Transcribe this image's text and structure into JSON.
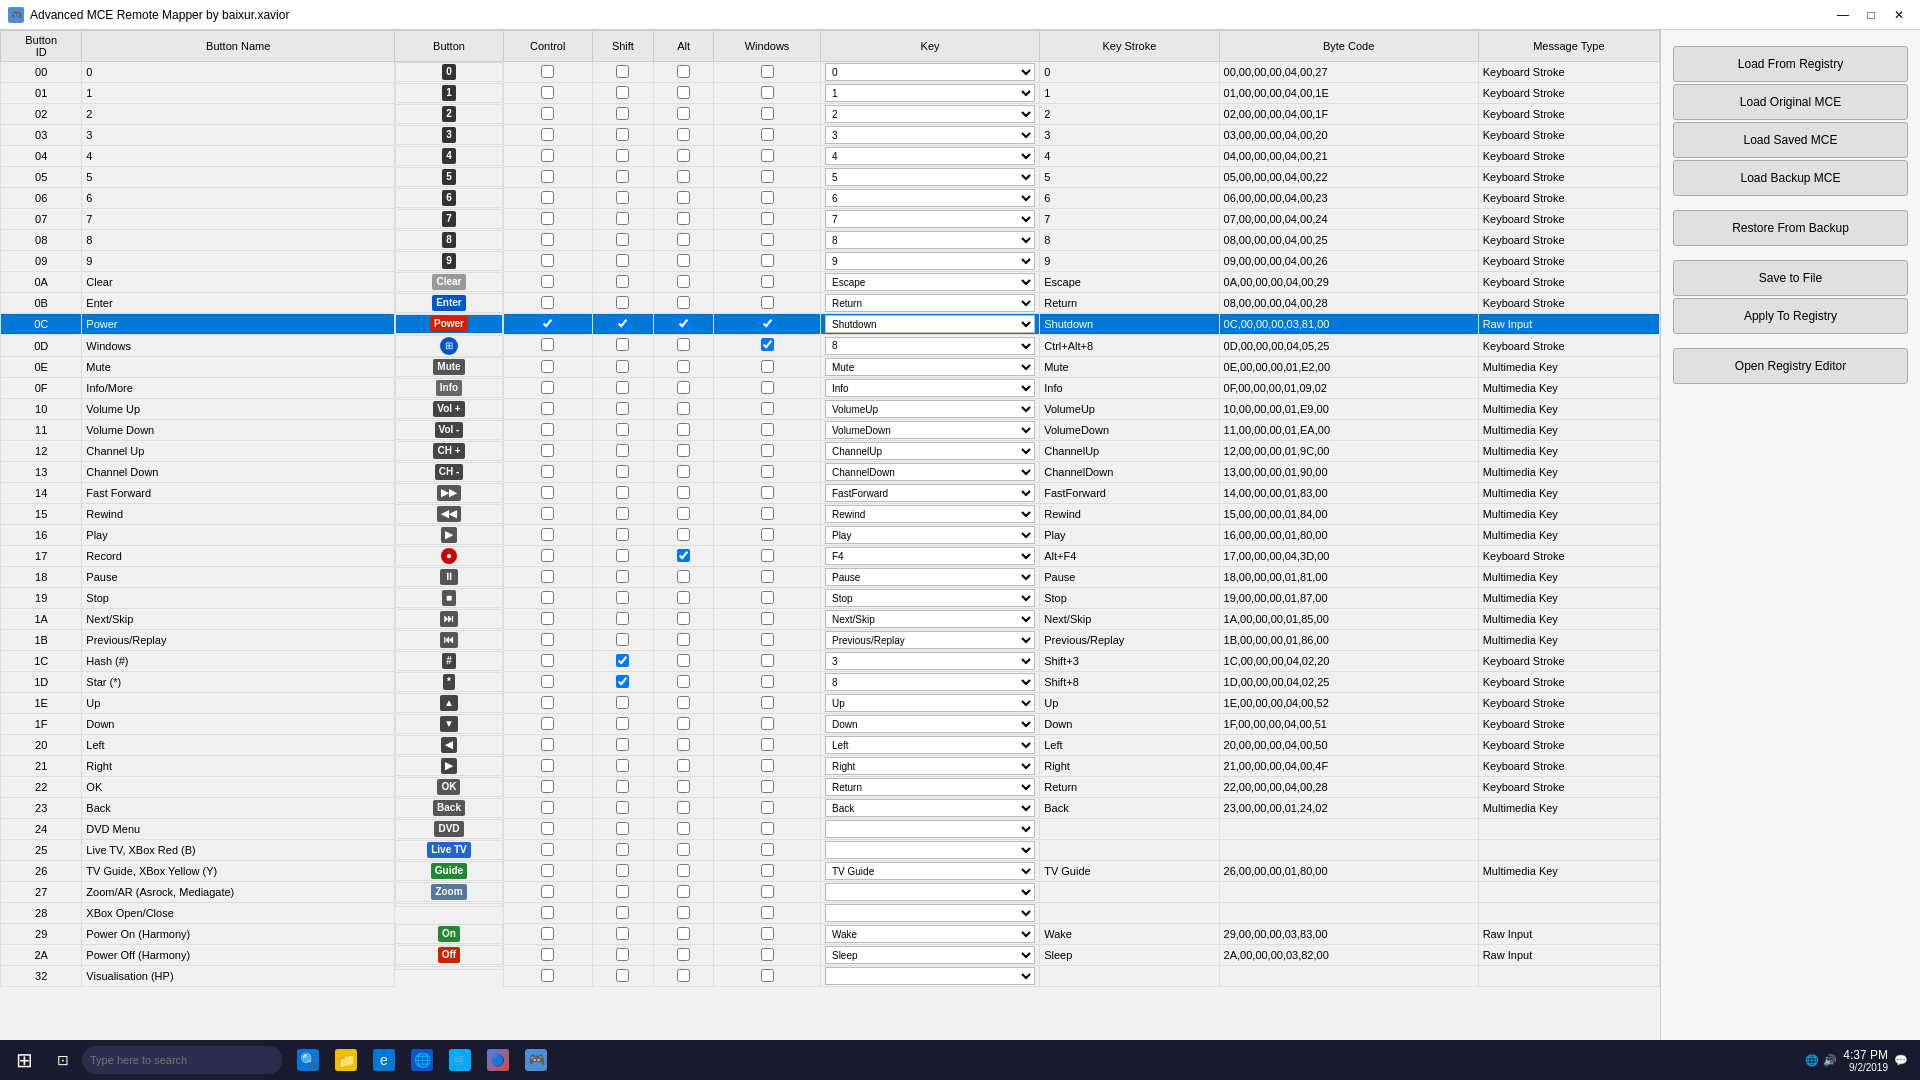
{
  "app": {
    "title": "Advanced MCE Remote Mapper by baixur.xavior",
    "icon": "🎮"
  },
  "titlebar": {
    "minimize": "—",
    "maximize": "□",
    "close": "✕"
  },
  "table": {
    "headers": [
      "Button ID",
      "Button Name",
      "Button",
      "Control",
      "Shift",
      "Alt",
      "Windows",
      "Key",
      "Key Stroke",
      "Byte Code",
      "Message Type"
    ],
    "rows": [
      {
        "id": "00",
        "name": "0",
        "btn": "0",
        "btn_class": "btn-dark",
        "ctrl": false,
        "shift": false,
        "alt": false,
        "win": false,
        "key": "0",
        "keystroke": "0",
        "bytecode": "00,00,00,00,04,00,27",
        "msgtype": "Keyboard Stroke"
      },
      {
        "id": "01",
        "name": "1",
        "btn": "1",
        "btn_class": "btn-dark",
        "ctrl": false,
        "shift": false,
        "alt": false,
        "win": false,
        "key": "1",
        "keystroke": "1",
        "bytecode": "01,00,00,00,04,00,1E",
        "msgtype": "Keyboard Stroke"
      },
      {
        "id": "02",
        "name": "2",
        "btn": "2",
        "btn_class": "btn-dark",
        "ctrl": false,
        "shift": false,
        "alt": false,
        "win": false,
        "key": "2",
        "keystroke": "2",
        "bytecode": "02,00,00,00,04,00,1F",
        "msgtype": "Keyboard Stroke"
      },
      {
        "id": "03",
        "name": "3",
        "btn": "3",
        "btn_class": "btn-dark",
        "ctrl": false,
        "shift": false,
        "alt": false,
        "win": false,
        "key": "3",
        "keystroke": "3",
        "bytecode": "03,00,00,00,04,00,20",
        "msgtype": "Keyboard Stroke"
      },
      {
        "id": "04",
        "name": "4",
        "btn": "4",
        "btn_class": "btn-dark",
        "ctrl": false,
        "shift": false,
        "alt": false,
        "win": false,
        "key": "4",
        "keystroke": "4",
        "bytecode": "04,00,00,00,04,00,21",
        "msgtype": "Keyboard Stroke"
      },
      {
        "id": "05",
        "name": "5",
        "btn": "5",
        "btn_class": "btn-dark",
        "ctrl": false,
        "shift": false,
        "alt": false,
        "win": false,
        "key": "5",
        "keystroke": "5",
        "bytecode": "05,00,00,00,04,00,22",
        "msgtype": "Keyboard Stroke"
      },
      {
        "id": "06",
        "name": "6",
        "btn": "6",
        "btn_class": "btn-dark",
        "ctrl": false,
        "shift": false,
        "alt": false,
        "win": false,
        "key": "6",
        "keystroke": "6",
        "bytecode": "06,00,00,00,04,00,23",
        "msgtype": "Keyboard Stroke"
      },
      {
        "id": "07",
        "name": "7",
        "btn": "7",
        "btn_class": "btn-dark",
        "ctrl": false,
        "shift": false,
        "alt": false,
        "win": false,
        "key": "7",
        "keystroke": "7",
        "bytecode": "07,00,00,00,04,00,24",
        "msgtype": "Keyboard Stroke"
      },
      {
        "id": "08",
        "name": "8",
        "btn": "8",
        "btn_class": "btn-dark",
        "ctrl": false,
        "shift": false,
        "alt": false,
        "win": false,
        "key": "8",
        "keystroke": "8",
        "bytecode": "08,00,00,00,04,00,25",
        "msgtype": "Keyboard Stroke"
      },
      {
        "id": "09",
        "name": "9",
        "btn": "9",
        "btn_class": "btn-dark",
        "ctrl": false,
        "shift": false,
        "alt": false,
        "win": false,
        "key": "9",
        "keystroke": "9",
        "bytecode": "09,00,00,00,04,00,26",
        "msgtype": "Keyboard Stroke"
      },
      {
        "id": "0A",
        "name": "Clear",
        "btn": "Clear",
        "btn_class": "btn-gray",
        "ctrl": false,
        "shift": false,
        "alt": false,
        "win": false,
        "key": "Escape",
        "keystroke": "Escape",
        "bytecode": "0A,00,00,00,04,00,29",
        "msgtype": "Keyboard Stroke"
      },
      {
        "id": "0B",
        "name": "Enter",
        "btn": "Enter",
        "btn_class": "btn-blue",
        "ctrl": false,
        "shift": false,
        "alt": false,
        "win": false,
        "key": "Return",
        "keystroke": "Return",
        "bytecode": "08,00,00,00,04,00,28",
        "msgtype": "Keyboard Stroke"
      },
      {
        "id": "0C",
        "name": "Power",
        "btn": "Power",
        "btn_class": "btn-power",
        "ctrl": true,
        "shift": true,
        "alt": true,
        "win": true,
        "key": "Shutdown",
        "keystroke": "Shutdown",
        "bytecode": "0C,00,00,00,03,81,00",
        "msgtype": "Raw Input",
        "selected": true
      },
      {
        "id": "0D",
        "name": "Windows",
        "btn": "win",
        "btn_class": "btn-windows",
        "ctrl": false,
        "shift": false,
        "alt": false,
        "win": true,
        "key": "8",
        "keystroke": "Ctrl+Alt+8",
        "bytecode": "0D,00,00,00,04,05,25",
        "msgtype": "Keyboard Stroke"
      },
      {
        "id": "0E",
        "name": "Mute",
        "btn": "Mute",
        "btn_class": "btn-mute",
        "ctrl": false,
        "shift": false,
        "alt": false,
        "win": false,
        "key": "Mute",
        "keystroke": "Mute",
        "bytecode": "0E,00,00,00,01,E2,00",
        "msgtype": "Multimedia Key"
      },
      {
        "id": "0F",
        "name": "Info/More",
        "btn": "Info",
        "btn_class": "btn-info",
        "ctrl": false,
        "shift": false,
        "alt": false,
        "win": false,
        "key": "Info",
        "keystroke": "Info",
        "bytecode": "0F,00,00,00,01,09,02",
        "msgtype": "Multimedia Key"
      },
      {
        "id": "10",
        "name": "Volume Up",
        "btn": "Vol +",
        "btn_class": "btn-volplus",
        "ctrl": false,
        "shift": false,
        "alt": false,
        "win": false,
        "key": "VolumeUp",
        "keystroke": "VolumeUp",
        "bytecode": "10,00,00,00,01,E9,00",
        "msgtype": "Multimedia Key"
      },
      {
        "id": "11",
        "name": "Volume Down",
        "btn": "Vol -",
        "btn_class": "btn-volminus",
        "ctrl": false,
        "shift": false,
        "alt": false,
        "win": false,
        "key": "VolumeDown",
        "keystroke": "VolumeDown",
        "bytecode": "11,00,00,00,01,EA,00",
        "msgtype": "Multimedia Key"
      },
      {
        "id": "12",
        "name": "Channel Up",
        "btn": "CH +",
        "btn_class": "btn-ch",
        "ctrl": false,
        "shift": false,
        "alt": false,
        "win": false,
        "key": "ChannelUp",
        "keystroke": "ChannelUp",
        "bytecode": "12,00,00,00,01,9C,00",
        "msgtype": "Multimedia Key"
      },
      {
        "id": "13",
        "name": "Channel Down",
        "btn": "CH -",
        "btn_class": "btn-ch",
        "ctrl": false,
        "shift": false,
        "alt": false,
        "win": false,
        "key": "ChannelDown",
        "keystroke": "ChannelDown",
        "bytecode": "13,00,00,00,01,90,00",
        "msgtype": "Multimedia Key"
      },
      {
        "id": "14",
        "name": "Fast Forward",
        "btn": "▶▶",
        "btn_class": "btn-ff",
        "ctrl": false,
        "shift": false,
        "alt": false,
        "win": false,
        "key": "FastForward",
        "keystroke": "FastForward",
        "bytecode": "14,00,00,00,01,83,00",
        "msgtype": "Multimedia Key"
      },
      {
        "id": "15",
        "name": "Rewind",
        "btn": "◀◀",
        "btn_class": "btn-rew",
        "ctrl": false,
        "shift": false,
        "alt": false,
        "win": false,
        "key": "Rewind",
        "keystroke": "Rewind",
        "bytecode": "15,00,00,00,01,84,00",
        "msgtype": "Multimedia Key"
      },
      {
        "id": "16",
        "name": "Play",
        "btn": "▶",
        "btn_class": "btn-play",
        "ctrl": false,
        "shift": false,
        "alt": false,
        "win": false,
        "key": "Play",
        "keystroke": "Play",
        "bytecode": "16,00,00,00,01,80,00",
        "msgtype": "Multimedia Key"
      },
      {
        "id": "17",
        "name": "Record",
        "btn": "●",
        "btn_class": "btn-rec",
        "ctrl": false,
        "shift": false,
        "alt": true,
        "win": false,
        "key": "F4",
        "keystroke": "Alt+F4",
        "bytecode": "17,00,00,00,04,3D,00",
        "msgtype": "Keyboard Stroke"
      },
      {
        "id": "18",
        "name": "Pause",
        "btn": "⏸",
        "btn_class": "btn-pause",
        "ctrl": false,
        "shift": false,
        "alt": false,
        "win": false,
        "key": "Pause",
        "keystroke": "Pause",
        "bytecode": "18,00,00,00,01,81,00",
        "msgtype": "Multimedia Key"
      },
      {
        "id": "19",
        "name": "Stop",
        "btn": "■",
        "btn_class": "btn-stop",
        "ctrl": false,
        "shift": false,
        "alt": false,
        "win": false,
        "key": "Stop",
        "keystroke": "Stop",
        "bytecode": "19,00,00,00,01,87,00",
        "msgtype": "Multimedia Key"
      },
      {
        "id": "1A",
        "name": "Next/Skip",
        "btn": "⏭",
        "btn_class": "btn-skip",
        "ctrl": false,
        "shift": false,
        "alt": false,
        "win": false,
        "key": "Next/Skip",
        "keystroke": "Next/Skip",
        "bytecode": "1A,00,00,00,01,85,00",
        "msgtype": "Multimedia Key"
      },
      {
        "id": "1B",
        "name": "Previous/Replay",
        "btn": "⏮",
        "btn_class": "btn-prev",
        "ctrl": false,
        "shift": false,
        "alt": false,
        "win": false,
        "key": "Previous/Replay",
        "keystroke": "Previous/Replay",
        "bytecode": "1B,00,00,00,01,86,00",
        "msgtype": "Multimedia Key"
      },
      {
        "id": "1C",
        "name": "Hash (#)",
        "btn": "#",
        "btn_class": "btn-hash",
        "ctrl": false,
        "shift": true,
        "alt": false,
        "win": false,
        "key": "3",
        "keystroke": "Shift+3",
        "bytecode": "1C,00,00,00,04,02,20",
        "msgtype": "Keyboard Stroke"
      },
      {
        "id": "1D",
        "name": "Star (*)",
        "btn": "*",
        "btn_class": "btn-star",
        "ctrl": false,
        "shift": true,
        "alt": false,
        "win": false,
        "key": "8",
        "keystroke": "Shift+8",
        "bytecode": "1D,00,00,00,04,02,25",
        "msgtype": "Keyboard Stroke"
      },
      {
        "id": "1E",
        "name": "Up",
        "btn": "▲",
        "btn_class": "btn-nav",
        "ctrl": false,
        "shift": false,
        "alt": false,
        "win": false,
        "key": "Up",
        "keystroke": "Up",
        "bytecode": "1E,00,00,00,04,00,52",
        "msgtype": "Keyboard Stroke"
      },
      {
        "id": "1F",
        "name": "Down",
        "btn": "▼",
        "btn_class": "btn-nav",
        "ctrl": false,
        "shift": false,
        "alt": false,
        "win": false,
        "key": "Down",
        "keystroke": "Down",
        "bytecode": "1F,00,00,00,04,00,51",
        "msgtype": "Keyboard Stroke"
      },
      {
        "id": "20",
        "name": "Left",
        "btn": "◀",
        "btn_class": "btn-nav",
        "ctrl": false,
        "shift": false,
        "alt": false,
        "win": false,
        "key": "Left",
        "keystroke": "Left",
        "bytecode": "20,00,00,00,04,00,50",
        "msgtype": "Keyboard Stroke"
      },
      {
        "id": "21",
        "name": "Right",
        "btn": "▶",
        "btn_class": "btn-nav",
        "ctrl": false,
        "shift": false,
        "alt": false,
        "win": false,
        "key": "Right",
        "keystroke": "Right",
        "bytecode": "21,00,00,00,04,00,4F",
        "msgtype": "Keyboard Stroke"
      },
      {
        "id": "22",
        "name": "OK",
        "btn": "OK",
        "btn_class": "btn-ok",
        "ctrl": false,
        "shift": false,
        "alt": false,
        "win": false,
        "key": "Return",
        "keystroke": "Return",
        "bytecode": "22,00,00,00,04,00,28",
        "msgtype": "Keyboard Stroke"
      },
      {
        "id": "23",
        "name": "Back",
        "btn": "Back",
        "btn_class": "btn-back",
        "ctrl": false,
        "shift": false,
        "alt": false,
        "win": false,
        "key": "Back",
        "keystroke": "Back",
        "bytecode": "23,00,00,00,01,24,02",
        "msgtype": "Multimedia Key"
      },
      {
        "id": "24",
        "name": "DVD Menu",
        "btn": "DVD",
        "btn_class": "btn-dvd",
        "ctrl": false,
        "shift": false,
        "alt": false,
        "win": false,
        "key": "",
        "keystroke": "",
        "bytecode": "",
        "msgtype": ""
      },
      {
        "id": "25",
        "name": "Live TV, XBox Red (B)",
        "btn": "Live TV",
        "btn_class": "btn-livetv",
        "ctrl": false,
        "shift": false,
        "alt": false,
        "win": false,
        "key": "",
        "keystroke": "",
        "bytecode": "",
        "msgtype": ""
      },
      {
        "id": "26",
        "name": "TV Guide, XBox Yellow (Y)",
        "btn": "Guide",
        "btn_class": "btn-guide",
        "ctrl": false,
        "shift": false,
        "alt": false,
        "win": false,
        "key": "TV Guide",
        "keystroke": "TV Guide",
        "bytecode": "26,00,00,00,01,80,00",
        "msgtype": "Multimedia Key"
      },
      {
        "id": "27",
        "name": "Zoom/AR (Asrock, Mediagate)",
        "btn": "Zoom",
        "btn_class": "btn-zoom",
        "ctrl": false,
        "shift": false,
        "alt": false,
        "win": false,
        "key": "",
        "keystroke": "",
        "bytecode": "",
        "msgtype": ""
      },
      {
        "id": "28",
        "name": "XBox Open/Close",
        "btn": "",
        "btn_class": "",
        "ctrl": false,
        "shift": false,
        "alt": false,
        "win": false,
        "key": "",
        "keystroke": "",
        "bytecode": "",
        "msgtype": ""
      },
      {
        "id": "29",
        "name": "Power On (Harmony)",
        "btn": "On",
        "btn_class": "btn-on",
        "ctrl": false,
        "shift": false,
        "alt": false,
        "win": false,
        "key": "Wake",
        "keystroke": "Wake",
        "bytecode": "29,00,00,00,03,83,00",
        "msgtype": "Raw Input"
      },
      {
        "id": "2A",
        "name": "Power Off (Harmony)",
        "btn": "Off",
        "btn_class": "btn-off",
        "ctrl": false,
        "shift": false,
        "alt": false,
        "win": false,
        "key": "Sleep",
        "keystroke": "Sleep",
        "bytecode": "2A,00,00,00,03,82,00",
        "msgtype": "Raw Input"
      },
      {
        "id": "32",
        "name": "Visualisation (HP)",
        "btn": "",
        "btn_class": "",
        "ctrl": false,
        "shift": false,
        "alt": false,
        "win": false,
        "key": "",
        "keystroke": "",
        "bytecode": "",
        "msgtype": ""
      }
    ]
  },
  "right_panel": {
    "buttons": [
      {
        "label": "Load From Registry",
        "key": "load_registry"
      },
      {
        "label": "Load Original MCE",
        "key": "load_original"
      },
      {
        "label": "Load Saved MCE",
        "key": "load_saved"
      },
      {
        "label": "Load Backup MCE",
        "key": "load_backup"
      },
      {
        "label": "Restore From Backup",
        "key": "restore_backup"
      },
      {
        "label": "Save to File",
        "key": "save_file"
      },
      {
        "label": "Apply To Registry",
        "key": "apply_registry"
      },
      {
        "label": "Open Registry Editor",
        "key": "open_registry"
      }
    ]
  },
  "taskbar": {
    "search_placeholder": "Type here to search",
    "time": "4:37 PM",
    "date": "9/2/2019",
    "app_active": "Advanced MCE Remote Mapper by baixur.xavior"
  }
}
